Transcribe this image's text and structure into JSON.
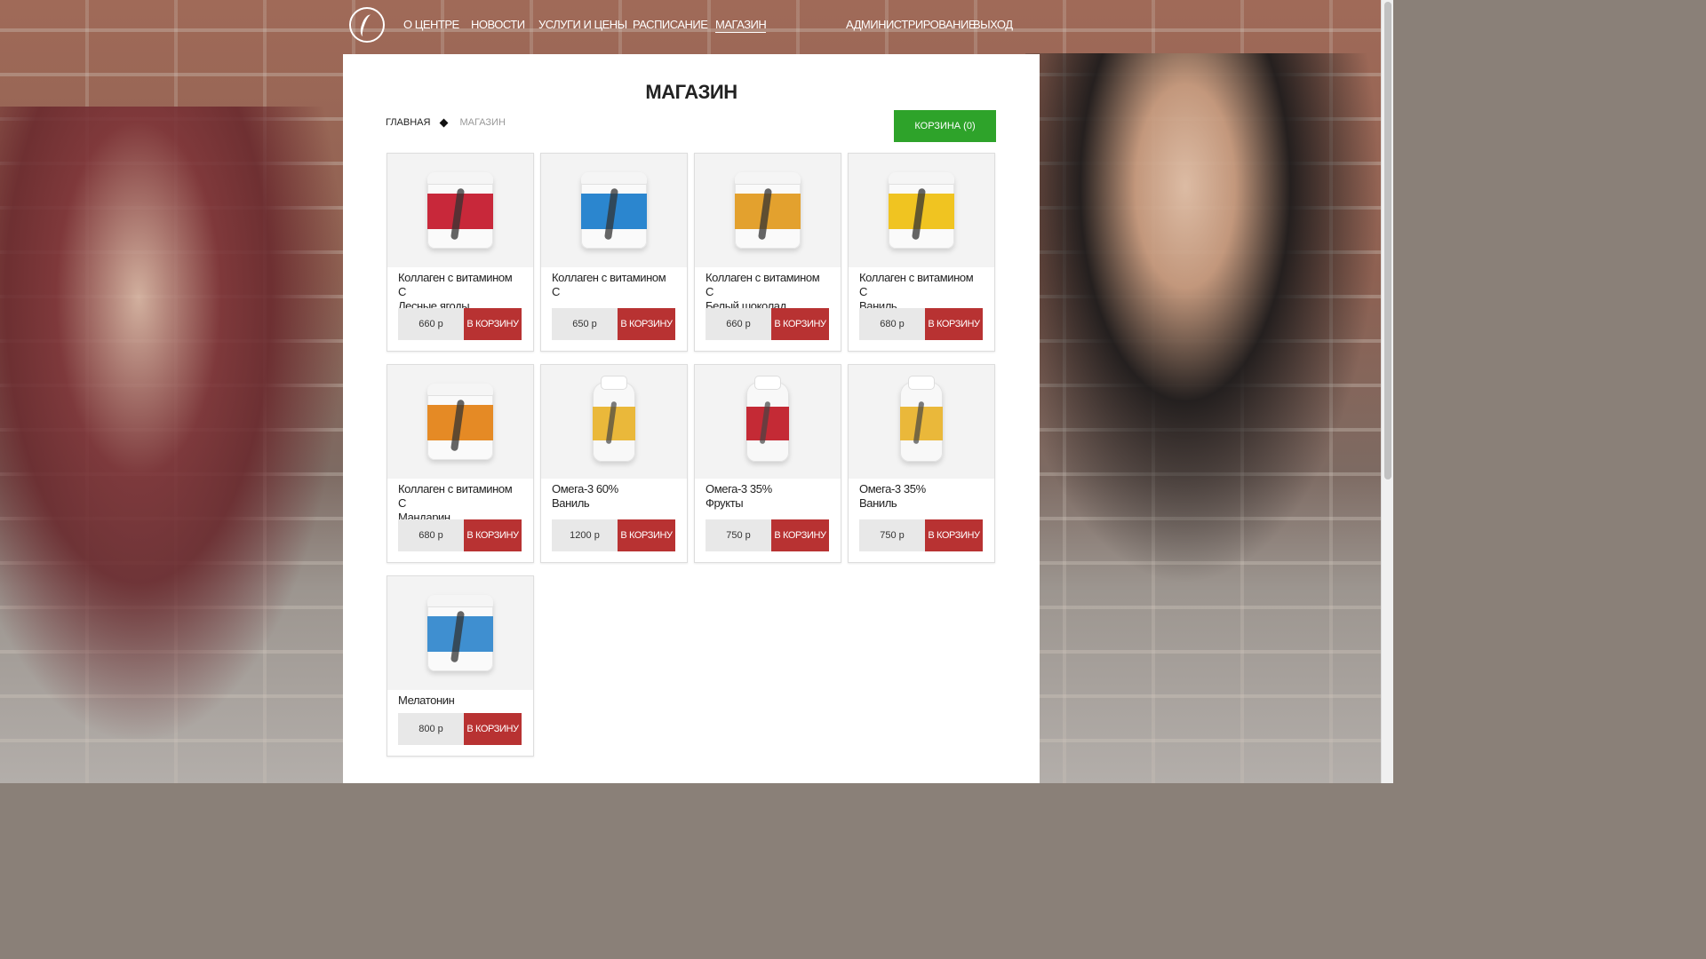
{
  "nav": {
    "items": [
      {
        "label": "О ЦЕНТРЕ"
      },
      {
        "label": "НОВОСТИ"
      },
      {
        "label": "УСЛУГИ И ЦЕНЫ"
      },
      {
        "label": "РАСПИСАНИЕ"
      },
      {
        "label": "МАГАЗИН",
        "active": true
      },
      {
        "label": "АДМИНИСТРИРОВАНИЕ"
      },
      {
        "label": "ВЫХОД"
      }
    ]
  },
  "page": {
    "title": "МАГАЗИН",
    "breadcrumb": {
      "home": "ГЛАВНАЯ",
      "current": "МАГАЗИН"
    },
    "cart_button": "КОРЗИНА (0)"
  },
  "products": [
    {
      "name_line1": "Коллаген с витамином С",
      "name_line2": "Лесные ягоды",
      "price": "660 р",
      "button": "В КОРЗИНУ",
      "package": "jar",
      "color": "#c8283a"
    },
    {
      "name_line1": "Коллаген с витамином С",
      "name_line2": "",
      "price": "650 р",
      "button": "В КОРЗИНУ",
      "package": "jar",
      "color": "#2b86cf"
    },
    {
      "name_line1": "Коллаген с витамином С",
      "name_line2": "Белый шоколад",
      "price": "660 р",
      "button": "В КОРЗИНУ",
      "package": "jar",
      "color": "#e3a12e"
    },
    {
      "name_line1": "Коллаген с витамином С",
      "name_line2": "Ваниль",
      "price": "680 р",
      "button": "В КОРЗИНУ",
      "package": "jar",
      "color": "#f0c421"
    },
    {
      "name_line1": "Коллаген с витамином С",
      "name_line2": "Мандарин",
      "price": "680 р",
      "button": "В КОРЗИНУ",
      "package": "jar",
      "color": "#e58a25"
    },
    {
      "name_line1": "Омега-3 60%",
      "name_line2": "Ваниль",
      "price": "1200 р",
      "button": "В КОРЗИНУ",
      "package": "bottle",
      "color": "#eab83a"
    },
    {
      "name_line1": "Омега-3 35%",
      "name_line2": "Фрукты",
      "price": "750 р",
      "button": "В КОРЗИНУ",
      "package": "bottle",
      "color": "#c42a35"
    },
    {
      "name_line1": "Омега-3 35%",
      "name_line2": "Ваниль",
      "price": "750 р",
      "button": "В КОРЗИНУ",
      "package": "bottle",
      "color": "#eab83a"
    },
    {
      "name_line1": "Мелатонин",
      "name_line2": "",
      "price": "800 р",
      "button": "В КОРЗИНУ",
      "package": "jar",
      "color": "#3f8fd0"
    }
  ]
}
